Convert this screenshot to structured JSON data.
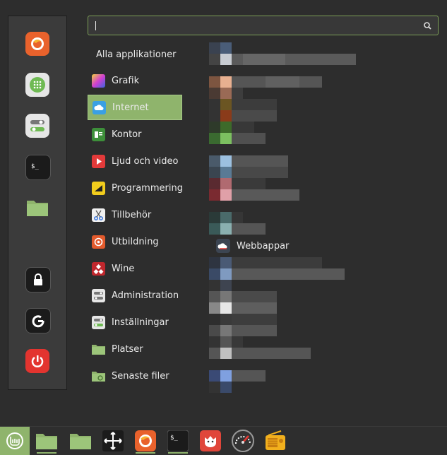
{
  "search": {
    "value": ""
  },
  "all_apps_label": "Alla applikationer",
  "categories": [
    {
      "label": "Grafik",
      "icon": "graphics-icon"
    },
    {
      "label": "Internet",
      "icon": "cloud-icon"
    },
    {
      "label": "Kontor",
      "icon": "office-icon"
    },
    {
      "label": "Ljud och video",
      "icon": "play-icon"
    },
    {
      "label": "Programmering",
      "icon": "programming-icon"
    },
    {
      "label": "Tillbehör",
      "icon": "scissors-icon"
    },
    {
      "label": "Utbildning",
      "icon": "education-icon"
    },
    {
      "label": "Wine",
      "icon": "wine-icon"
    },
    {
      "label": "Administration",
      "icon": "toggle-icon"
    },
    {
      "label": "Inställningar",
      "icon": "toggle-icon"
    },
    {
      "label": "Platser",
      "icon": "folder-icon"
    },
    {
      "label": "Senaste filer",
      "icon": "recent-folder-icon"
    }
  ],
  "selected_category": "Internet",
  "apps": [
    {
      "label": "Webbappar",
      "icon": "webapps-icon"
    }
  ],
  "favorites": [
    "firefox-icon",
    "software-manager-icon",
    "settings-icon",
    "terminal-icon",
    "folder-icon"
  ],
  "session": [
    "lock-icon",
    "logout-icon",
    "shutdown-icon"
  ],
  "taskbar": [
    "mint-menu-icon",
    "folder-icon",
    "folder-icon",
    "move-icon",
    "firefox-icon",
    "terminal-icon",
    "gimp-icon",
    "speedometer-icon",
    "radio-icon"
  ],
  "colors": {
    "accent": "#8fb46c",
    "background": "#2d2d2d",
    "panel": "#3b3b3b"
  }
}
